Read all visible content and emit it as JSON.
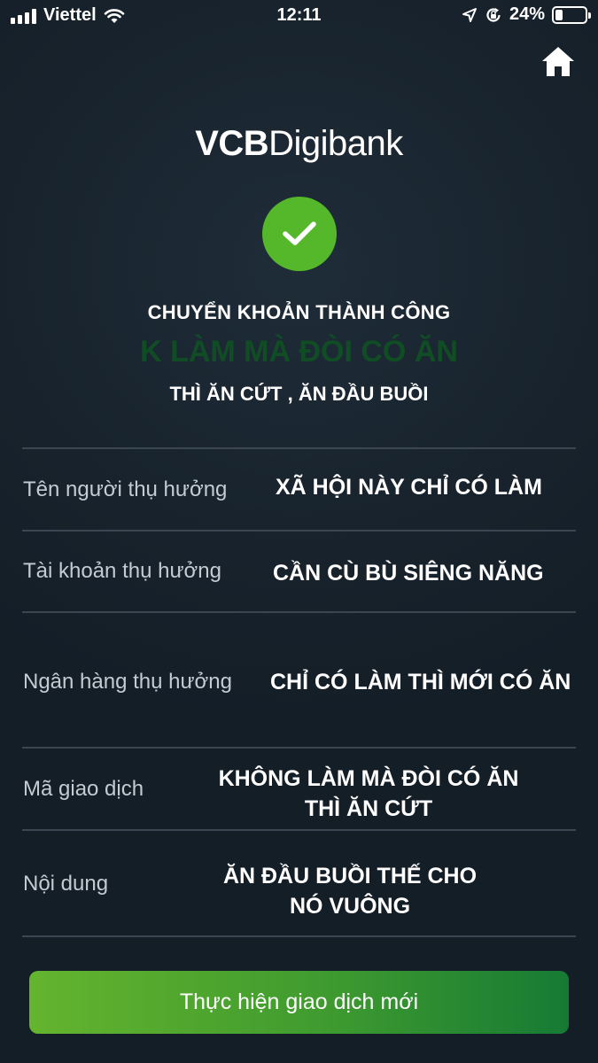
{
  "status_bar": {
    "carrier": "Viettel",
    "time": "12:11",
    "battery_percent": "24%",
    "battery_level": 0.24,
    "icons": [
      "signal-icon",
      "wifi-icon",
      "location-arrow-icon",
      "rotation-lock-icon",
      "battery-icon"
    ]
  },
  "header": {
    "home_icon": "home-icon",
    "brand_part1": "VCB",
    "brand_part2": "Digibank"
  },
  "result": {
    "icon": "checkmark-icon",
    "title": "CHUYỂN KHOẢN THÀNH CÔNG",
    "amount": "K LÀM MÀ ĐÒI CÓ ĂN",
    "subtitle": "THÌ ĂN CỨT , ĂN ĐẦU BUỒI"
  },
  "details": [
    {
      "label": "Tên người thụ hưởng",
      "value": "XÃ HỘI NÀY CHỈ CÓ LÀM"
    },
    {
      "label": "Tài khoản thụ hưởng",
      "value": "CẦN CÙ BÙ SIÊNG NĂNG"
    },
    {
      "label": "Ngân hàng thụ hưởng",
      "value": "CHỈ CÓ LÀM THÌ MỚI CÓ ĂN"
    },
    {
      "label": "Mã giao dịch",
      "value_line1": "KHÔNG LÀM MÀ ĐÒI CÓ ĂN",
      "value_line2": "THÌ ĂN CỨT"
    },
    {
      "label": "Nội dung",
      "value_line1": "ĂN ĐẦU BUỒI THẾ CHO",
      "value_line2": "NÓ VUÔNG"
    }
  ],
  "actions": {
    "new_transaction_label": "Thực hiện giao dịch mới"
  },
  "colors": {
    "background": "#16212b",
    "accent_green": "#55b82a",
    "amount_green": "#114d24"
  }
}
